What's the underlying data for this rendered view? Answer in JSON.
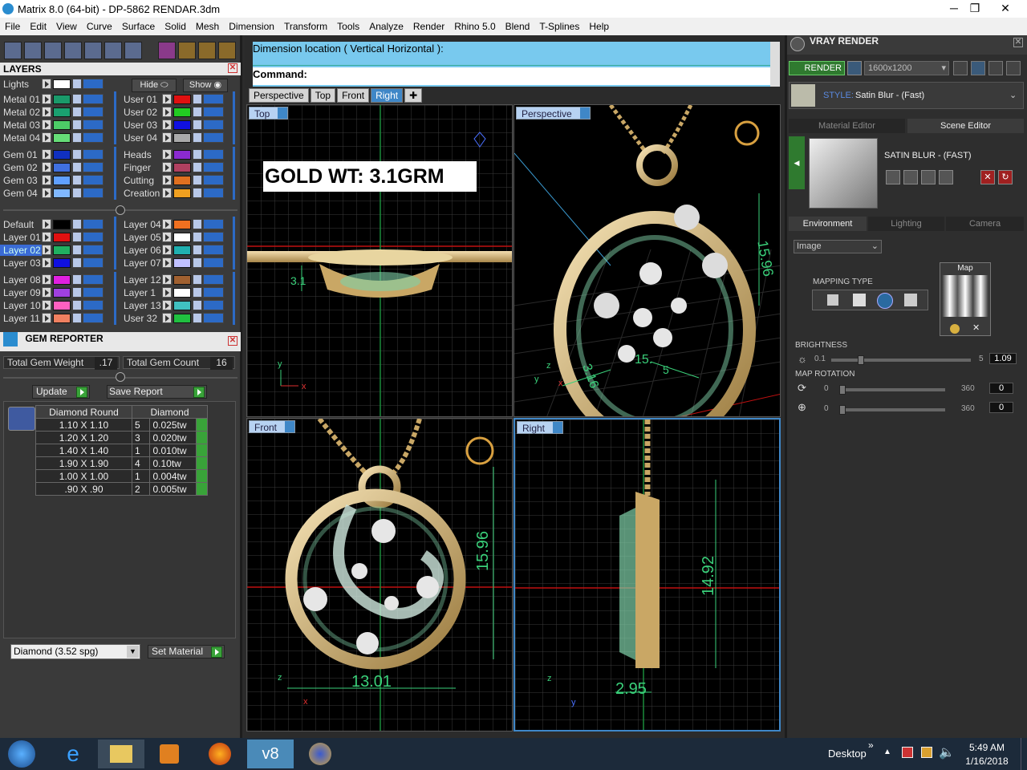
{
  "window": {
    "title": "Matrix 8.0 (64-bit) - DP-5862 RENDAR.3dm",
    "minimize": "─",
    "maximize": "❐",
    "close": "✕"
  },
  "menu": [
    "File",
    "Edit",
    "View",
    "Curve",
    "Surface",
    "Solid",
    "Mesh",
    "Dimension",
    "Transform",
    "Tools",
    "Analyze",
    "Render",
    "Rhino 5.0",
    "Blend",
    "T-Splines",
    "Help"
  ],
  "layers": {
    "title": "LAYERS",
    "lights": "Lights",
    "hide": "Hide",
    "show": "Show",
    "group1_left": [
      {
        "name": "Metal 01",
        "color": "#1a9a6a"
      },
      {
        "name": "Metal 02",
        "color": "#1aa070"
      },
      {
        "name": "Metal 03",
        "color": "#4ccc66"
      },
      {
        "name": "Metal 04",
        "color": "#66dd77"
      }
    ],
    "group1_right": [
      {
        "name": "User 01",
        "color": "#e01010"
      },
      {
        "name": "User 02",
        "color": "#22cc22"
      },
      {
        "name": "User 03",
        "color": "#1010e0"
      },
      {
        "name": "User 04",
        "color": "#aaaaaa"
      }
    ],
    "group2_left": [
      {
        "name": "Gem 01",
        "color": "#1030c0"
      },
      {
        "name": "Gem 02",
        "color": "#4070e0"
      },
      {
        "name": "Gem 03",
        "color": "#60a0ff"
      },
      {
        "name": "Gem 04",
        "color": "#80b8ff"
      }
    ],
    "group2_right": [
      {
        "name": "Heads",
        "color": "#8a2ad0"
      },
      {
        "name": "Finger",
        "color": "#b04060"
      },
      {
        "name": "Cutting",
        "color": "#e07020"
      },
      {
        "name": "Creation",
        "color": "#f0a020"
      }
    ],
    "group3_left": [
      {
        "name": "Default",
        "color": "#000000"
      },
      {
        "name": "Layer 01",
        "color": "#e01010"
      },
      {
        "name": "Layer 02",
        "color": "#20b060"
      },
      {
        "name": "Layer 03",
        "color": "#1010e0"
      }
    ],
    "group3_right": [
      {
        "name": "Layer 04",
        "color": "#f07020"
      },
      {
        "name": "Layer 05",
        "color": "#ffffff"
      },
      {
        "name": "Layer 06",
        "color": "#20b0b0"
      },
      {
        "name": "Layer 07",
        "color": "#c0c0ff"
      }
    ],
    "group4_left": [
      {
        "name": "Layer 08",
        "color": "#e020e0"
      },
      {
        "name": "Layer 09",
        "color": "#a040e0"
      },
      {
        "name": "Layer 10",
        "color": "#ff60c0"
      },
      {
        "name": "Layer 11",
        "color": "#f08060"
      }
    ],
    "group4_right": [
      {
        "name": "Layer 12",
        "color": "#a06030"
      },
      {
        "name": "Layer 1",
        "color": "#ffffff"
      },
      {
        "name": "Layer 13",
        "color": "#40c0c0"
      },
      {
        "name": "User 32",
        "color": "#20c040"
      }
    ]
  },
  "gem_reporter": {
    "title": "GEM REPORTER",
    "total_weight_label": "Total Gem Weight",
    "total_weight": ".17",
    "total_count_label": "Total Gem Count",
    "total_count": "16",
    "update": "Update",
    "save_report": "Save Report",
    "col1": "Diamond Round",
    "col2": "Diamond",
    "rows": [
      {
        "size": "1.10 X 1.10",
        "count": "5",
        "wt": "0.025tw"
      },
      {
        "size": "1.20 X 1.20",
        "count": "3",
        "wt": "0.020tw"
      },
      {
        "size": "1.40 X 1.40",
        "count": "1",
        "wt": "0.010tw"
      },
      {
        "size": "1.90 X 1.90",
        "count": "4",
        "wt": "0.10tw"
      },
      {
        "size": "1.00 X 1.00",
        "count": "1",
        "wt": "0.004tw"
      },
      {
        "size": ".90 X .90",
        "count": "2",
        "wt": "0.005tw"
      }
    ],
    "material_select": "Diamond    (3.52 spg)",
    "set_material": "Set Material"
  },
  "command": {
    "history": "Dimension location ( Vertical  Horizontal ):",
    "prompt": "Command:"
  },
  "view_tabs": [
    "Perspective",
    "Top",
    "Front",
    "Right"
  ],
  "active_tab": "Right",
  "viewports": {
    "top": {
      "label": "Top",
      "annotation": "GOLD WT: 3.1GRM",
      "dim": "3.1"
    },
    "perspective": {
      "label": "Perspective",
      "dims": [
        "15.96",
        "3.16",
        "15.",
        "5"
      ]
    },
    "front": {
      "label": "Front",
      "dim_v": "15.96",
      "dim_h": "13.01"
    },
    "right": {
      "label": "Right",
      "dim_v": "14.92",
      "dim_h": "2.95"
    }
  },
  "axes": {
    "x": "x",
    "y": "y",
    "z": "z"
  },
  "vray": {
    "title": "VRAY RENDER",
    "render": "RENDER",
    "resolution": "1600x1200",
    "style_label": "STYLE:",
    "style_value": "Satin Blur - (Fast)",
    "tab_material": "Material Editor",
    "tab_scene": "Scene Editor",
    "material_name": "SATIN BLUR - (FAST)",
    "env_tabs": [
      "Environment",
      "Lighting",
      "Camera"
    ],
    "env_source": "Image",
    "mapping_type": "MAPPING TYPE",
    "map_label": "Map",
    "brightness_label": "BRIGHTNESS",
    "brightness_min": "0.1",
    "brightness_max": "5",
    "brightness_value": "1.09",
    "brightness_level": 0.2,
    "map_rotation_label": "MAP ROTATION",
    "rot1_min": "0",
    "rot1_max": "360",
    "rot1_value": "0",
    "rot2_min": "0",
    "rot2_max": "360",
    "rot2_value": "0"
  },
  "taskbar": {
    "desktop": "Desktop",
    "time": "5:49 AM",
    "date": "1/16/2018",
    "v8": "v8"
  }
}
